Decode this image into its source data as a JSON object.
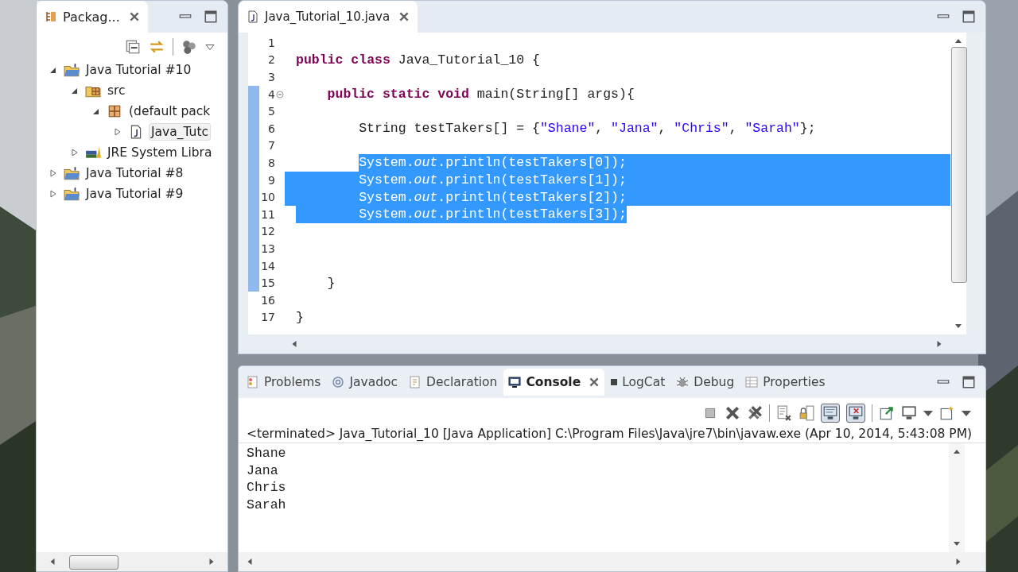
{
  "explorer": {
    "tab": {
      "label": "Packag...",
      "selected": true
    },
    "tree": [
      {
        "label": "Java Tutorial #10",
        "kind": "project",
        "expanded": true,
        "children": [
          {
            "label": "src",
            "kind": "source",
            "expanded": true,
            "children": [
              {
                "label": "(default pack",
                "kind": "package",
                "expanded": true,
                "children": [
                  {
                    "label": "Java_Tutc",
                    "kind": "file",
                    "expanded": false,
                    "selected": true
                  }
                ]
              }
            ]
          },
          {
            "label": "JRE System Libra",
            "kind": "library",
            "expanded": false
          }
        ]
      },
      {
        "label": "Java Tutorial #8",
        "kind": "project",
        "expanded": false
      },
      {
        "label": "Java Tutorial #9",
        "kind": "project",
        "expanded": false
      }
    ]
  },
  "editor": {
    "tab": {
      "label": "Java_Tutorial_10.java",
      "selected": true
    },
    "lines": [
      {
        "number": "1",
        "marked": false,
        "fold": false,
        "selected": false
      },
      {
        "number": "2",
        "marked": false,
        "fold": false,
        "selected": false,
        "tokens": [
          {
            "kind": "keyword",
            "text": "public"
          },
          {
            "kind": "keyword",
            "text": " class"
          },
          {
            "kind": "plain",
            "text": " Java_Tutorial_10 {"
          }
        ]
      },
      {
        "number": "3",
        "marked": false,
        "fold": false,
        "selected": false
      },
      {
        "number": "4",
        "marked": true,
        "fold": true,
        "selected": false,
        "tokens": [
          {
            "kind": "keyword",
            "text": "    public"
          },
          {
            "kind": "keyword",
            "text": " static"
          },
          {
            "kind": "keyword",
            "text": " void"
          },
          {
            "kind": "plain",
            "text": " main(String[] args){"
          }
        ]
      },
      {
        "number": "5",
        "marked": true,
        "fold": false,
        "selected": false
      },
      {
        "number": "6",
        "marked": true,
        "fold": false,
        "selected": false,
        "tokens": [
          {
            "kind": "plain",
            "text": "        String testTakers[] = {"
          },
          {
            "kind": "string",
            "text": "\"Shane\""
          },
          {
            "kind": "plain",
            "text": ", "
          },
          {
            "kind": "string",
            "text": "\"Jana\""
          },
          {
            "kind": "plain",
            "text": ", "
          },
          {
            "kind": "string",
            "text": "\"Chris\""
          },
          {
            "kind": "plain",
            "text": ", "
          },
          {
            "kind": "string",
            "text": "\"Sarah\""
          },
          {
            "kind": "plain",
            "text": "};"
          }
        ]
      },
      {
        "number": "7",
        "marked": true,
        "fold": false,
        "selected": false
      },
      {
        "number": "8",
        "marked": true,
        "fold": false,
        "selected": true,
        "tokens": [
          {
            "kind": "plain",
            "text": "        System."
          },
          {
            "kind": "field",
            "text": "out"
          },
          {
            "kind": "plain",
            "text": ".println(testTakers[0]);"
          }
        ]
      },
      {
        "number": "9",
        "marked": true,
        "fold": false,
        "selected": true,
        "tokens": [
          {
            "kind": "plain",
            "text": "        System."
          },
          {
            "kind": "field",
            "text": "out"
          },
          {
            "kind": "plain",
            "text": ".println(testTakers[1]);"
          }
        ]
      },
      {
        "number": "10",
        "marked": true,
        "fold": false,
        "selected": true,
        "tokens": [
          {
            "kind": "plain",
            "text": "        System."
          },
          {
            "kind": "field",
            "text": "out"
          },
          {
            "kind": "plain",
            "text": ".println(testTakers[2]);"
          }
        ]
      },
      {
        "number": "11",
        "marked": true,
        "fold": false,
        "selected": true,
        "tokens": [
          {
            "kind": "plain",
            "text": "        System."
          },
          {
            "kind": "field",
            "text": "out"
          },
          {
            "kind": "plain",
            "text": ".println(testTakers[3]);"
          }
        ]
      },
      {
        "number": "12",
        "marked": true,
        "fold": false,
        "selected": false
      },
      {
        "number": "13",
        "marked": true,
        "fold": false,
        "selected": false
      },
      {
        "number": "14",
        "marked": true,
        "fold": false,
        "selected": false
      },
      {
        "number": "15",
        "marked": true,
        "fold": false,
        "selected": false,
        "tokens": [
          {
            "kind": "plain",
            "text": "    }"
          }
        ]
      },
      {
        "number": "16",
        "marked": false,
        "fold": false,
        "selected": false
      },
      {
        "number": "17",
        "marked": false,
        "fold": false,
        "selected": false,
        "tokens": [
          {
            "kind": "plain",
            "text": "}"
          }
        ]
      }
    ]
  },
  "console": {
    "tabs": [
      {
        "label": "Problems",
        "kind": "problems",
        "selected": false
      },
      {
        "label": "Javadoc",
        "kind": "javadoc",
        "selected": false
      },
      {
        "label": "Declaration",
        "kind": "declaration",
        "selected": false
      },
      {
        "label": "Console",
        "kind": "console",
        "selected": true
      },
      {
        "label": "LogCat",
        "kind": "logcat",
        "selected": false
      },
      {
        "label": "Debug",
        "kind": "debug",
        "selected": false
      },
      {
        "label": "Properties",
        "kind": "properties",
        "selected": false
      }
    ],
    "status": "<terminated> Java_Tutorial_10 [Java Application] C:\\Program Files\\Java\\jre7\\bin\\javaw.exe (Apr 10, 2014, 5:43:08 PM)",
    "output": [
      "Shane",
      "Jana",
      "Chris",
      "Sarah"
    ]
  }
}
